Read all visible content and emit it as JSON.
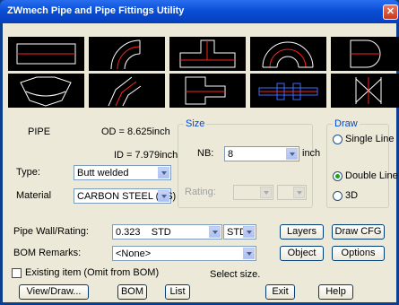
{
  "window": {
    "title": "ZWmech Pipe and Pipe Fittings Utility",
    "close_icon": "close-icon"
  },
  "thumbnails": [
    {
      "name": "pipe-straight"
    },
    {
      "name": "elbow-90"
    },
    {
      "name": "tee"
    },
    {
      "name": "elbow-180"
    },
    {
      "name": "cap"
    },
    {
      "name": "reducer"
    },
    {
      "name": "elbow-45"
    },
    {
      "name": "reducer-eccentric"
    },
    {
      "name": "flange"
    },
    {
      "name": "valve"
    }
  ],
  "info": {
    "component": "PIPE",
    "od": "OD = 8.625inch",
    "id": "ID = 7.979inch"
  },
  "type": {
    "label": "Type:",
    "value": "Butt welded"
  },
  "material": {
    "label": "Material",
    "value": "CARBON STEEL (CS)"
  },
  "size": {
    "caption": "Size",
    "nb_label": "NB:",
    "nb_value": "8",
    "unit": "inch",
    "rating_label": "Rating:"
  },
  "draw": {
    "caption": "Draw",
    "options": [
      "Single Line",
      "Double Line",
      "3D"
    ],
    "selected": "Double Line"
  },
  "wall": {
    "label": "Pipe Wall/Rating:",
    "value": "0.323    STD",
    "std": "STD"
  },
  "bom": {
    "label": "BOM Remarks:",
    "value": "<None>"
  },
  "existing": {
    "label": "Existing item (Omit from BOM)"
  },
  "status": "Select size.",
  "buttons": {
    "layers": "Layers",
    "draw_cfg": "Draw CFG",
    "object": "Object",
    "options": "Options",
    "view_draw": "View/Draw...",
    "bom": "BOM",
    "list": "List",
    "exit": "Exit",
    "help": "Help"
  },
  "colors": {
    "title_bar": "#0a4fd6",
    "dialog_bg": "#ece9d8",
    "group_caption": "#0046d5",
    "drawing_red": "#ff2020"
  }
}
